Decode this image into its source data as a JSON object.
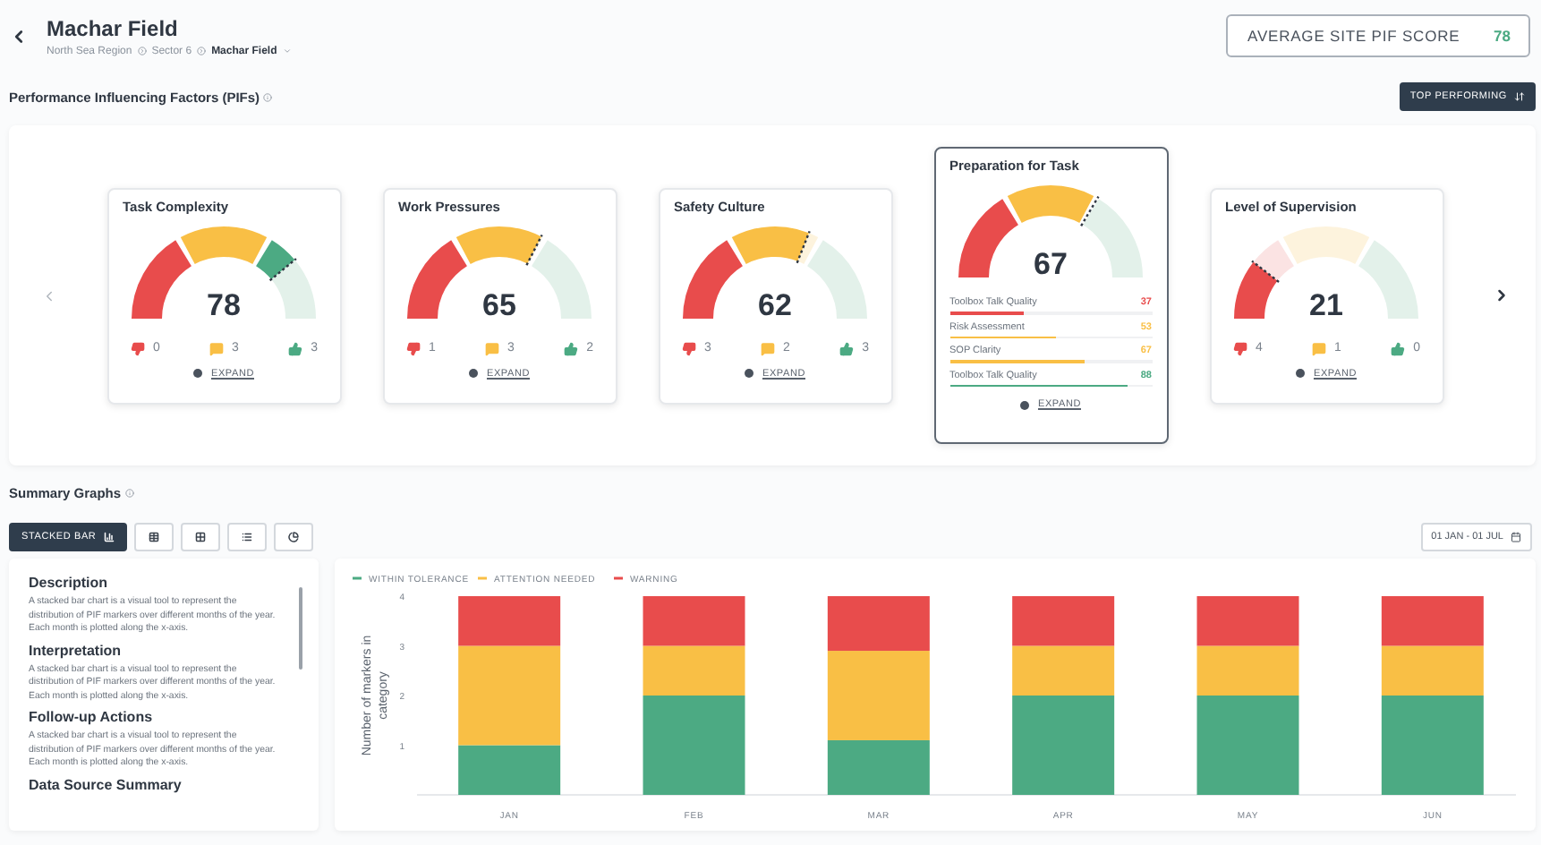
{
  "header": {
    "title": "Machar Field",
    "breadcrumb": [
      "North Sea Region",
      "Sector 6",
      "Machar Field"
    ]
  },
  "score": {
    "label": "AVERAGE SITE PIF SCORE",
    "value": "78"
  },
  "pifs": {
    "title": "Performance Influencing Factors (PIFs)",
    "sort_button": "TOP PERFORMING",
    "cards": [
      {
        "title": "Task Complexity",
        "score": "78",
        "selected": false,
        "warning": "0",
        "attention": "3",
        "within": "3",
        "expand": "EXPAND"
      },
      {
        "title": "Work Pressures",
        "score": "65",
        "selected": false,
        "warning": "1",
        "attention": "3",
        "within": "2",
        "expand": "EXPAND"
      },
      {
        "title": "Safety Culture",
        "score": "62",
        "selected": false,
        "warning": "3",
        "attention": "2",
        "within": "3",
        "expand": "EXPAND"
      },
      {
        "title": "Preparation for Task",
        "score": "67",
        "selected": true,
        "expand": "EXPAND",
        "factors": [
          {
            "name": "Toolbox Talk Quality",
            "value": "37",
            "level": 0.37,
            "color": "#e84c4c"
          },
          {
            "name": "Risk Assessment",
            "value": "53",
            "level": 0.53,
            "color": "#f9bf45"
          },
          {
            "name": "SOP Clarity",
            "value": "67",
            "level": 0.67,
            "color": "#f9bf45"
          },
          {
            "name": "Toolbox Talk Quality",
            "value": "88",
            "level": 0.88,
            "color": "#4caa83"
          }
        ]
      },
      {
        "title": "Level of Supervision",
        "score": "21",
        "selected": false,
        "warning": "4",
        "attention": "1",
        "within": "0",
        "expand": "EXPAND"
      }
    ]
  },
  "summary": {
    "title": "Summary Graphs",
    "chart_types": [
      {
        "kind": "stacked_bar",
        "label": "STACKED BAR",
        "selected": true
      },
      {
        "kind": "table",
        "selected": false
      },
      {
        "kind": "grid",
        "selected": false
      },
      {
        "kind": "list",
        "selected": false
      },
      {
        "kind": "pie",
        "selected": false
      }
    ],
    "date_range": "01 JAN - 01 JUL",
    "sections": [
      {
        "heading": "Description",
        "text": "A stacked bar chart is a visual tool to represent the distribution of PIF markers over different months of the year. Each month is plotted along the x-axis."
      },
      {
        "heading": "Interpretation",
        "text": "A stacked bar chart is a visual tool to represent the distribution of PIF markers over different months of the year. Each month is plotted along the x-axis."
      },
      {
        "heading": "Follow-up Actions",
        "text": "A stacked bar chart is a visual tool to represent the distribution of PIF markers over different months of the year. Each month is plotted along the x-axis."
      },
      {
        "heading": "Data Source Summary"
      }
    ],
    "chart_data": {
      "type": "bar",
      "stacked": true,
      "legend": "top",
      "ylabel": "Number of markers in category",
      "categories": [
        "JAN",
        "FEB",
        "MAR",
        "APR",
        "MAY",
        "JUN"
      ],
      "ylim": [
        0,
        4
      ],
      "yticks": [
        1,
        2,
        3,
        4
      ],
      "series": [
        {
          "name": "WITHIN TOLERANCE",
          "color": "#4caa83",
          "values": [
            1,
            2,
            1.1,
            2,
            2,
            2
          ]
        },
        {
          "name": "ATTENTION NEEDED",
          "color": "#f9bf45",
          "values": [
            2,
            1,
            1.8,
            1,
            1,
            1
          ]
        },
        {
          "name": "WARNING",
          "color": "#e84c4c",
          "values": [
            1,
            1,
            1.1,
            1,
            1,
            1
          ]
        }
      ]
    }
  }
}
